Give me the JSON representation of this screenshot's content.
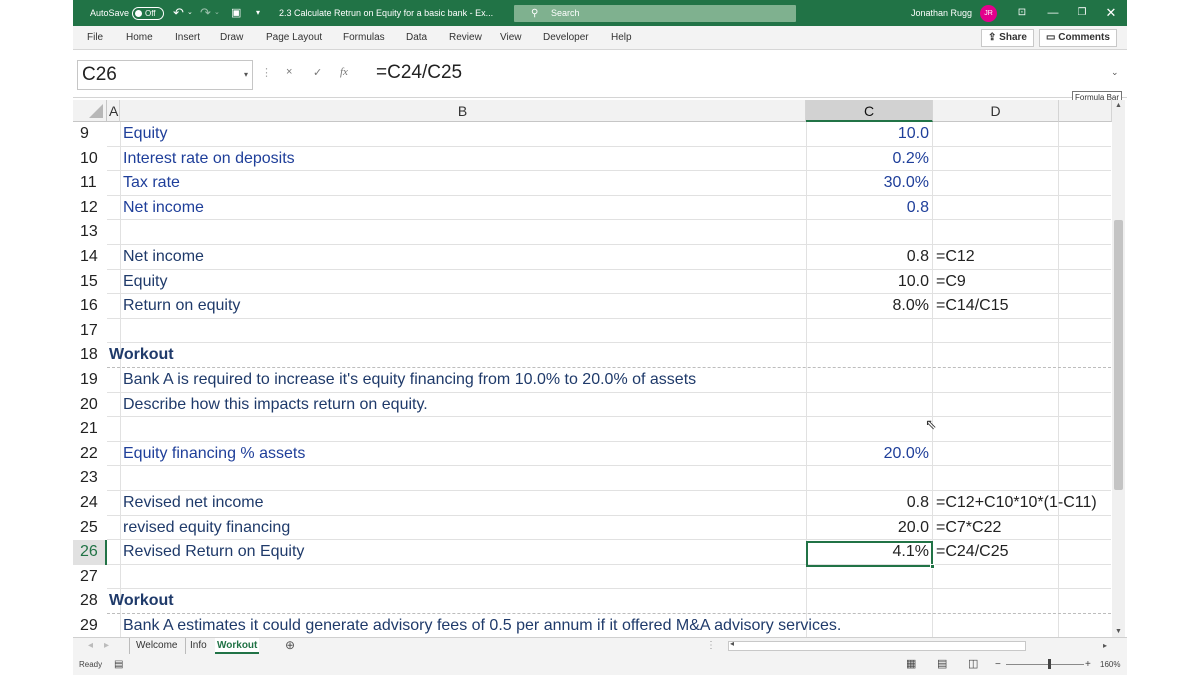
{
  "titlebar": {
    "autosave_label": "AutoSave",
    "autosave_state": "Off",
    "file_title": "2.3 Calculate Retrun on Equity for a basic bank  -  Ex...",
    "search_label": "Search",
    "user_name": "Jonathan Rugg",
    "user_initials": "JR"
  },
  "ribbon": {
    "tabs": [
      "File",
      "Home",
      "Insert",
      "Draw",
      "Page Layout",
      "Formulas",
      "Data",
      "Review",
      "View",
      "Developer",
      "Help"
    ],
    "share_label": "Share",
    "comments_label": "Comments"
  },
  "formula_bar": {
    "name_box": "C26",
    "formula": "=C24/C25",
    "tooltip": "Formula Bar",
    "cancel": "×",
    "enter": "✓",
    "fx": "fx"
  },
  "columns": [
    "A",
    "B",
    "C",
    "D"
  ],
  "selected_column": "C",
  "rows": [
    {
      "num": "9",
      "a": "",
      "b": "Equity",
      "c": "10.0",
      "d": "",
      "style": "blue"
    },
    {
      "num": "10",
      "a": "",
      "b": "Interest rate on deposits",
      "c": "0.2%",
      "d": "",
      "style": "blue"
    },
    {
      "num": "11",
      "a": "",
      "b": "Tax rate",
      "c": "30.0%",
      "d": "",
      "style": "blue"
    },
    {
      "num": "12",
      "a": "",
      "b": "Net income",
      "c": "0.8",
      "d": "",
      "style": "blue"
    },
    {
      "num": "13",
      "a": "",
      "b": "",
      "c": "",
      "d": "",
      "style": "blue"
    },
    {
      "num": "14",
      "a": "",
      "b": "Net income",
      "c": "0.8",
      "d": "=C12",
      "style": "dark"
    },
    {
      "num": "15",
      "a": "",
      "b": "Equity",
      "c": "10.0",
      "d": "=C9",
      "style": "dark"
    },
    {
      "num": "16",
      "a": "",
      "b": "Return on equity",
      "c": "8.0%",
      "d": "=C14/C15",
      "style": "dark"
    },
    {
      "num": "17",
      "a": "",
      "b": "",
      "c": "",
      "d": "",
      "style": "dark"
    },
    {
      "num": "18",
      "a": "Workout",
      "b": "",
      "c": "",
      "d": "",
      "style": "dark"
    },
    {
      "num": "19",
      "a": "",
      "b": "Bank A is required to increase it's equity financing from 10.0% to 20.0% of assets",
      "c": "",
      "d": "",
      "style": "dark"
    },
    {
      "num": "20",
      "a": "",
      "b": "Describe how this impacts return on equity.",
      "c": "",
      "d": "",
      "style": "dark"
    },
    {
      "num": "21",
      "a": "",
      "b": "",
      "c": "",
      "d": "",
      "style": "dark"
    },
    {
      "num": "22",
      "a": "",
      "b": "Equity financing % assets",
      "c": "20.0%",
      "d": "",
      "style": "blue"
    },
    {
      "num": "23",
      "a": "",
      "b": "",
      "c": "",
      "d": "",
      "style": "dark"
    },
    {
      "num": "24",
      "a": "",
      "b": "Revised net income",
      "c": "0.8",
      "d": "=C12+C10*10*(1-C11)",
      "style": "dark"
    },
    {
      "num": "25",
      "a": "",
      "b": "revised equity financing",
      "c": "20.0",
      "d": "=C7*C22",
      "style": "dark"
    },
    {
      "num": "26",
      "a": "",
      "b": "Revised Return on Equity",
      "c": "4.1%",
      "d": "=C24/C25",
      "style": "dark"
    },
    {
      "num": "27",
      "a": "",
      "b": "",
      "c": "",
      "d": "",
      "style": "dark"
    },
    {
      "num": "28",
      "a": "Workout",
      "b": "",
      "c": "",
      "d": "",
      "style": "dark"
    },
    {
      "num": "29",
      "a": "",
      "b": "Bank A estimates it could generate advisory fees of 0.5 per annum if it offered M&A advisory services.",
      "c": "",
      "d": "",
      "style": "dark"
    }
  ],
  "sheets": [
    "Welcome",
    "Info",
    "Workout"
  ],
  "active_sheet": "Workout",
  "status": {
    "mode": "Ready",
    "zoom": "160%"
  }
}
